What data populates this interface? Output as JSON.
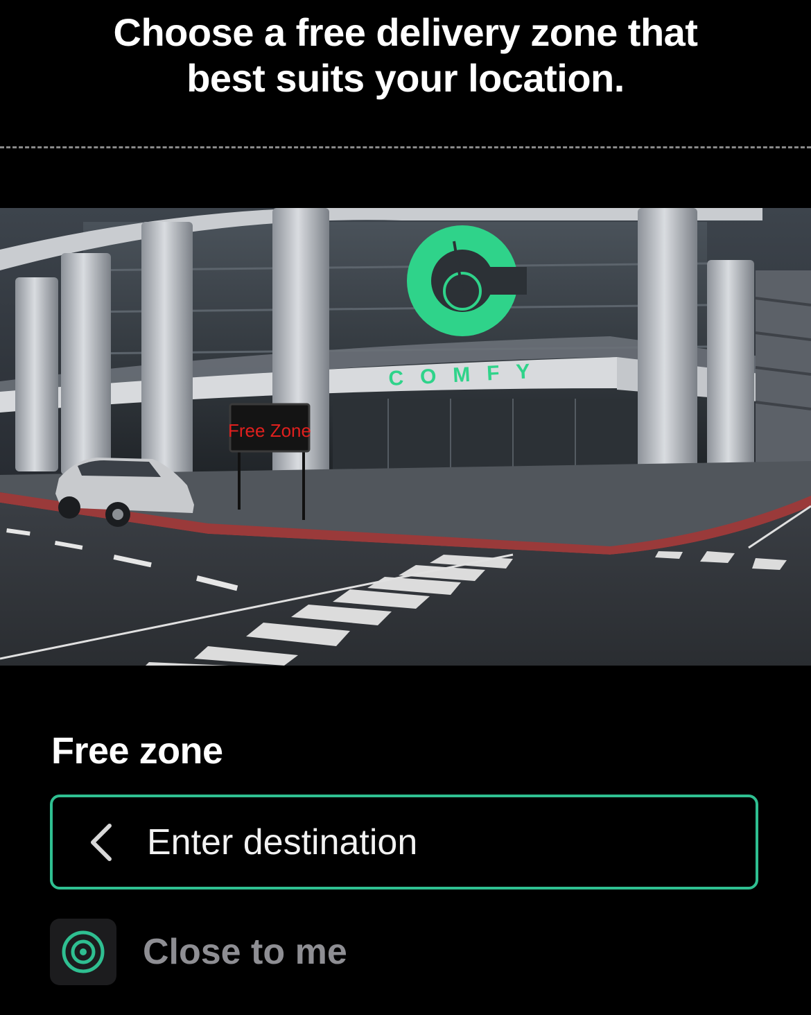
{
  "header": {
    "line1": "Choose a free delivery zone that",
    "line2": "best suits your location."
  },
  "hero": {
    "sign_text": "Free Zone",
    "brand_text": "COMFY",
    "brand_color": "#2fd38a",
    "sign_color": "#e0201e"
  },
  "zone": {
    "title": "Free zone",
    "destination_placeholder": "Enter destination",
    "close_to_me_label": "Close to me",
    "accent_color": "#2fbf91"
  },
  "icons": {
    "back": "chevron-left-icon",
    "target": "target-icon"
  }
}
